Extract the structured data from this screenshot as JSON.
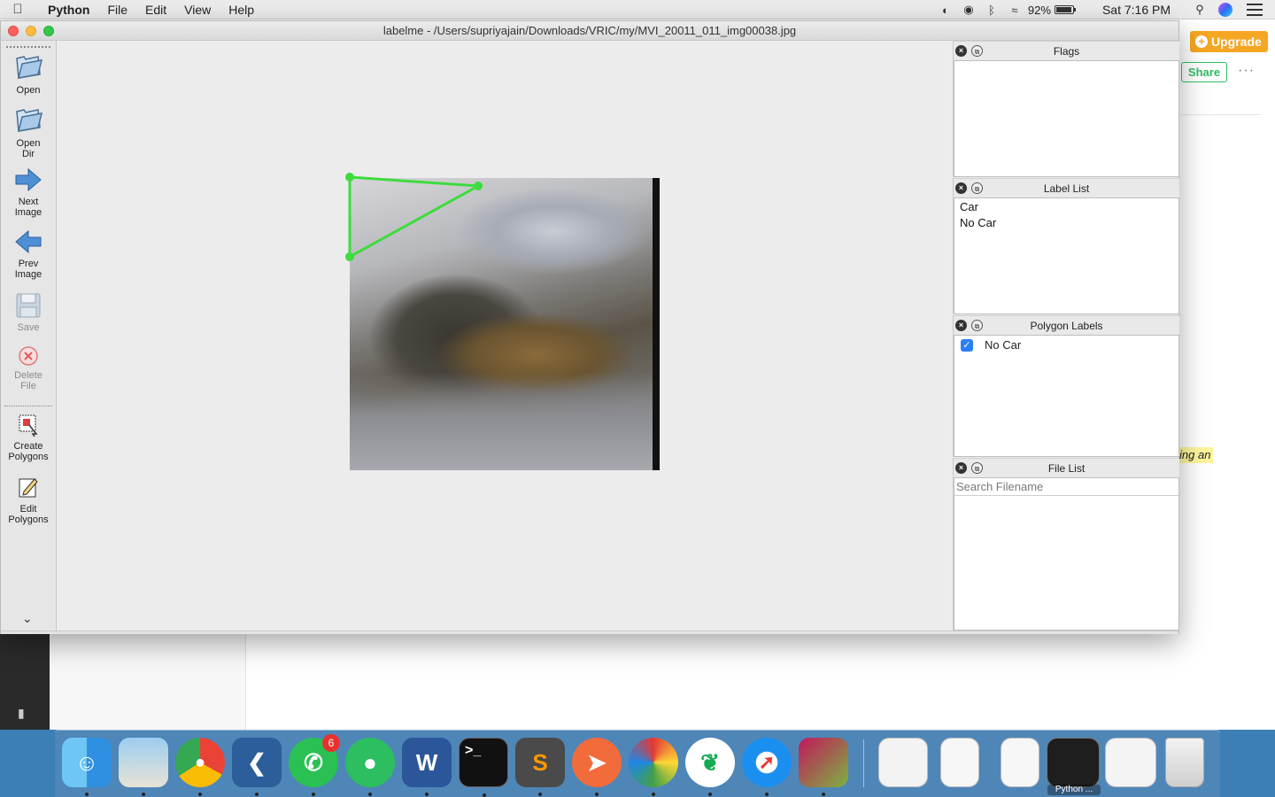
{
  "menubar": {
    "app_name": "Python",
    "menus": [
      "File",
      "Edit",
      "View",
      "Help"
    ],
    "battery": "92%",
    "clock": "Sat 7:16 PM"
  },
  "background_app": {
    "upgrade_label": "Upgrade",
    "share_label": "Share",
    "more_label": "···",
    "highlight_text": "ing an"
  },
  "window": {
    "title": "labelme - /Users/supriyajain/Downloads/VRIC/my/MVI_20011_011_img00038.jpg"
  },
  "toolbar": {
    "open": "Open",
    "open_dir_1": "Open",
    "open_dir_2": "Dir",
    "next_1": "Next",
    "next_2": "Image",
    "prev_1": "Prev",
    "prev_2": "Image",
    "save": "Save",
    "delete_1": "Delete",
    "delete_2": "File",
    "create_1": "Create",
    "create_2": "Polygons",
    "edit_1": "Edit",
    "edit_2": "Polygons"
  },
  "panels": {
    "flags": {
      "title": "Flags"
    },
    "label_list": {
      "title": "Label List",
      "items": [
        "Car",
        "No Car"
      ]
    },
    "polygon_labels": {
      "title": "Polygon Labels",
      "items": [
        {
          "label": "No Car",
          "checked": true
        }
      ]
    },
    "file_list": {
      "title": "File List",
      "search_placeholder": "Search Filename"
    }
  },
  "dock": {
    "whatsapp_badge": "6",
    "python_caption": "Python ..."
  },
  "colors": {
    "polygon": "#3ddc3d",
    "upgrade": "#f5a623",
    "share": "#2dbe60",
    "checkbox": "#2a7ff6"
  }
}
